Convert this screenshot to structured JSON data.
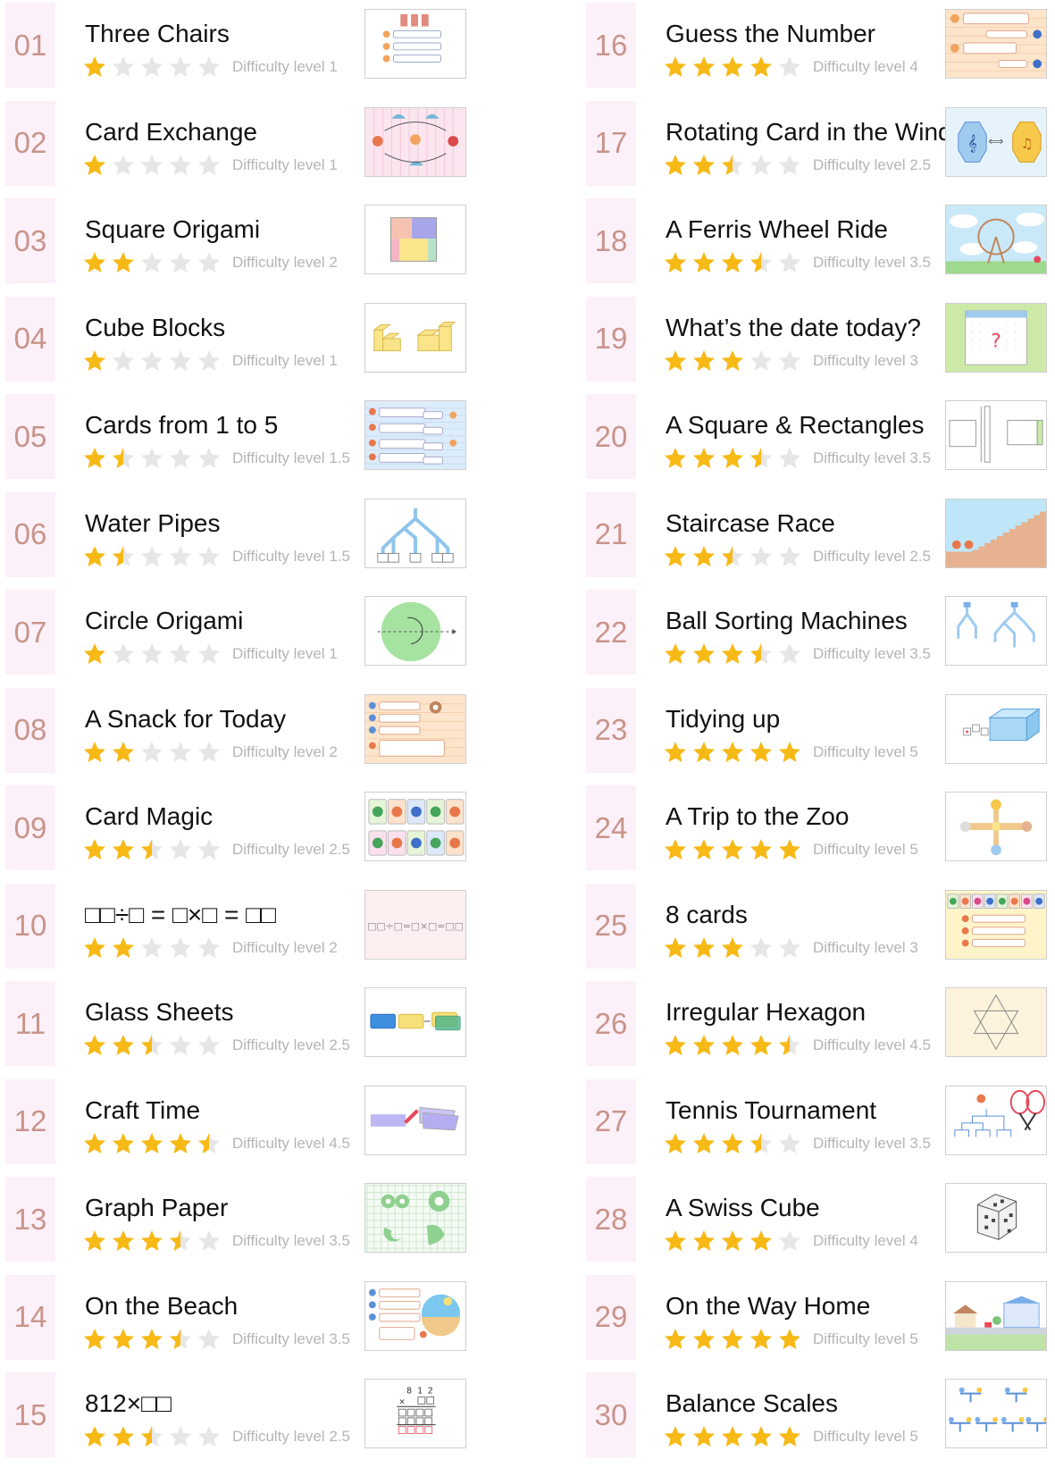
{
  "colors": {
    "number_bg": "#fcf0f9",
    "number_text": "#c8948a",
    "star_filled": "#f7b916",
    "star_empty": "#e6e6e6",
    "difficulty_text": "#b5b5b5",
    "title_text": "#111111"
  },
  "items": [
    {
      "num": "01",
      "title": "Three Chairs",
      "difficulty": "Difficulty level 1",
      "rating": 1,
      "thumb": "chairs-thumbnail"
    },
    {
      "num": "02",
      "title": "Card Exchange",
      "difficulty": "Difficulty level 1",
      "rating": 1,
      "thumb": "card-exchange-thumbnail"
    },
    {
      "num": "03",
      "title": "Square Origami",
      "difficulty": "Difficulty level 2",
      "rating": 2,
      "thumb": "square-origami-thumbnail"
    },
    {
      "num": "04",
      "title": "Cube Blocks",
      "difficulty": "Difficulty level 1",
      "rating": 1,
      "thumb": "cube-blocks-thumbnail"
    },
    {
      "num": "05",
      "title": "Cards from 1 to 5",
      "difficulty": "Difficulty level 1.5",
      "rating": 1.5,
      "thumb": "cards-dialog-thumbnail"
    },
    {
      "num": "06",
      "title": "Water Pipes",
      "difficulty": "Difficulty level 1.5",
      "rating": 1.5,
      "thumb": "water-pipes-thumbnail"
    },
    {
      "num": "07",
      "title": "Circle Origami",
      "difficulty": "Difficulty level 1",
      "rating": 1,
      "thumb": "circle-origami-thumbnail"
    },
    {
      "num": "08",
      "title": "A Snack for Today",
      "difficulty": "Difficulty level 2",
      "rating": 2,
      "thumb": "snack-dialog-thumbnail"
    },
    {
      "num": "09",
      "title": "Card Magic",
      "difficulty": "Difficulty level 2.5",
      "rating": 2.5,
      "thumb": "card-magic-thumbnail"
    },
    {
      "num": "10",
      "title": "□□÷□ = □×□ = □□",
      "difficulty": "Difficulty level 2",
      "rating": 2,
      "thumb": "equation-thumbnail",
      "thumb_text": "□□÷□=□×□=□□"
    },
    {
      "num": "11",
      "title": "Glass Sheets",
      "difficulty": "Difficulty level 2.5",
      "rating": 2.5,
      "thumb": "glass-sheets-thumbnail"
    },
    {
      "num": "12",
      "title": "Craft Time",
      "difficulty": "Difficulty level 4.5",
      "rating": 4.5,
      "thumb": "craft-time-thumbnail"
    },
    {
      "num": "13",
      "title": "Graph Paper",
      "difficulty": "Difficulty level 3.5",
      "rating": 3.5,
      "thumb": "graph-paper-thumbnail"
    },
    {
      "num": "14",
      "title": "On the Beach",
      "difficulty": "Difficulty level 3.5",
      "rating": 3.5,
      "thumb": "beach-thumbnail"
    },
    {
      "num": "15",
      "title": "812×□□",
      "difficulty": "Difficulty level 2.5",
      "rating": 2.5,
      "thumb": "multiplication-thumbnail",
      "thumb_text": "8 1 2"
    },
    {
      "num": "16",
      "title": "Guess the Number",
      "difficulty": "Difficulty level 4",
      "rating": 4,
      "thumb": "guess-dialog-thumbnail"
    },
    {
      "num": "17",
      "title": "Rotating Card in the Wind",
      "difficulty": "Difficulty level 2.5",
      "rating": 2.5,
      "thumb": "rotating-card-thumbnail"
    },
    {
      "num": "18",
      "title": "A Ferris Wheel Ride",
      "difficulty": "Difficulty level 3.5",
      "rating": 3.5,
      "thumb": "ferris-wheel-thumbnail"
    },
    {
      "num": "19",
      "title": "What’s the date today?",
      "difficulty": "Difficulty level 3",
      "rating": 3,
      "thumb": "calendar-thumbnail"
    },
    {
      "num": "20",
      "title": "A Square & Rectangles",
      "difficulty": "Difficulty level 3.5",
      "rating": 3.5,
      "thumb": "square-rectangles-thumbnail"
    },
    {
      "num": "21",
      "title": "Staircase Race",
      "difficulty": "Difficulty level 2.5",
      "rating": 2.5,
      "thumb": "staircase-thumbnail"
    },
    {
      "num": "22",
      "title": "Ball Sorting Machines",
      "difficulty": "Difficulty level 3.5",
      "rating": 3.5,
      "thumb": "ball-sorting-thumbnail"
    },
    {
      "num": "23",
      "title": "Tidying up",
      "difficulty": "Difficulty level 5",
      "rating": 5,
      "thumb": "tidying-thumbnail"
    },
    {
      "num": "24",
      "title": "A Trip to the Zoo",
      "difficulty": "Difficulty level 5",
      "rating": 5,
      "thumb": "zoo-map-thumbnail"
    },
    {
      "num": "25",
      "title": "8 cards",
      "difficulty": "Difficulty level 3",
      "rating": 3,
      "thumb": "eight-cards-thumbnail"
    },
    {
      "num": "26",
      "title": "Irregular Hexagon",
      "difficulty": "Difficulty level 4.5",
      "rating": 4.5,
      "thumb": "hexagon-thumbnail"
    },
    {
      "num": "27",
      "title": "Tennis Tournament",
      "difficulty": "Difficulty level 3.5",
      "rating": 3.5,
      "thumb": "tennis-thumbnail"
    },
    {
      "num": "28",
      "title": "A Swiss Cube",
      "difficulty": "Difficulty level 4",
      "rating": 4,
      "thumb": "swiss-cube-thumbnail"
    },
    {
      "num": "29",
      "title": "On the Way Home",
      "difficulty": "Difficulty level 5",
      "rating": 5,
      "thumb": "way-home-thumbnail"
    },
    {
      "num": "30",
      "title": "Balance Scales",
      "difficulty": "Difficulty level 5",
      "rating": 5,
      "thumb": "balance-scales-thumbnail"
    }
  ]
}
